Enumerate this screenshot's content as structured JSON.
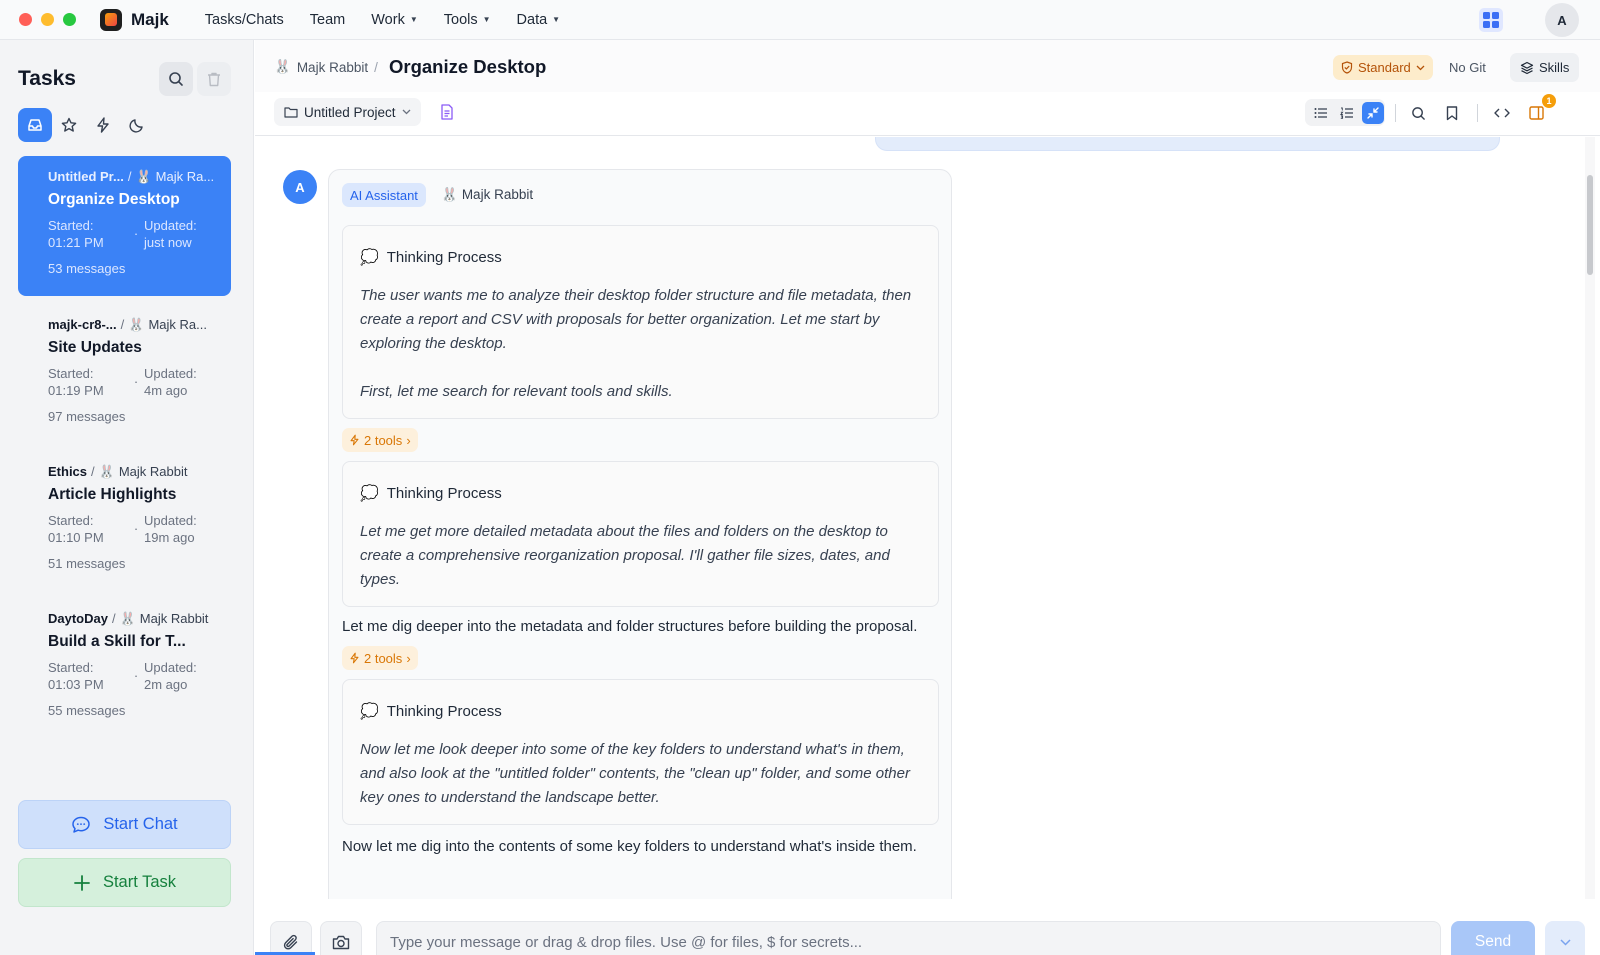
{
  "app": {
    "name": "Majk"
  },
  "menu": [
    {
      "label": "Tasks/Chats",
      "dropdown": false
    },
    {
      "label": "Team",
      "dropdown": false
    },
    {
      "label": "Work",
      "dropdown": true
    },
    {
      "label": "Tools",
      "dropdown": true
    },
    {
      "label": "Data",
      "dropdown": true
    }
  ],
  "user": {
    "initial": "A"
  },
  "sidebar": {
    "title": "Tasks",
    "tasks": [
      {
        "project": "Untitled Pr...",
        "agent": "Majk Ra...",
        "title": "Organize Desktop",
        "started_label": "Started:",
        "started": "01:21 PM",
        "updated_label": "Updated:",
        "updated": "just now",
        "messages": "53 messages",
        "active": true
      },
      {
        "project": "majk-cr8-...",
        "agent": "Majk Ra...",
        "title": "Site Updates",
        "started_label": "Started:",
        "started": "01:19 PM",
        "updated_label": "Updated:",
        "updated": "4m ago",
        "messages": "97 messages",
        "active": false
      },
      {
        "project": "Ethics",
        "agent": "Majk Rabbit",
        "title": "Article Highlights",
        "started_label": "Started:",
        "started": "01:10 PM",
        "updated_label": "Updated:",
        "updated": "19m ago",
        "messages": "51 messages",
        "active": false
      },
      {
        "project": "DaytoDay",
        "agent": "Majk Rabbit",
        "title": "Build a Skill for T...",
        "started_label": "Started:",
        "started": "01:03 PM",
        "updated_label": "Updated:",
        "updated": "2m ago",
        "messages": "55 messages",
        "active": false
      }
    ],
    "start_chat": "Start Chat",
    "start_task": "Start Task"
  },
  "header": {
    "agent": "Majk Rabbit",
    "separator": "/",
    "title": "Organize Desktop",
    "mode": "Standard",
    "git": "No Git",
    "skills": "Skills",
    "project": "Untitled Project",
    "panel_badge": "1"
  },
  "conversation": {
    "avatar_initial": "A",
    "role_badge": "AI Assistant",
    "agent": "Majk Rabbit",
    "think_heading": "Thinking Process",
    "thinking_1": [
      "The user wants me to analyze their desktop folder structure and file metadata, then create a report and CSV with proposals for better organization. Let me start by exploring the desktop.",
      "First, let me search for relevant tools and skills."
    ],
    "tools_1": "2 tools",
    "thinking_2": "Let me get more detailed metadata about the files and folders on the desktop to create a comprehensive reorganization proposal. I'll gather file sizes, dates, and types.",
    "reply_1": "Let me dig deeper into the metadata and folder structures before building the proposal.",
    "tools_2": "2 tools",
    "thinking_3": "Now let me look deeper into some of the key folders to understand what's in them, and also look at the \"untitled folder\" contents, the \"clean up\" folder, and some other key ones to understand the landscape better.",
    "reply_2": "Now let me dig into the contents of some key folders to understand what's inside them."
  },
  "composer": {
    "placeholder": "Type your message or drag & drop files. Use @ for files, $ for secrets...",
    "send": "Send"
  },
  "colors": {
    "accent": "#3b82f6",
    "tools": "#d97706",
    "standard": "#b45309"
  }
}
